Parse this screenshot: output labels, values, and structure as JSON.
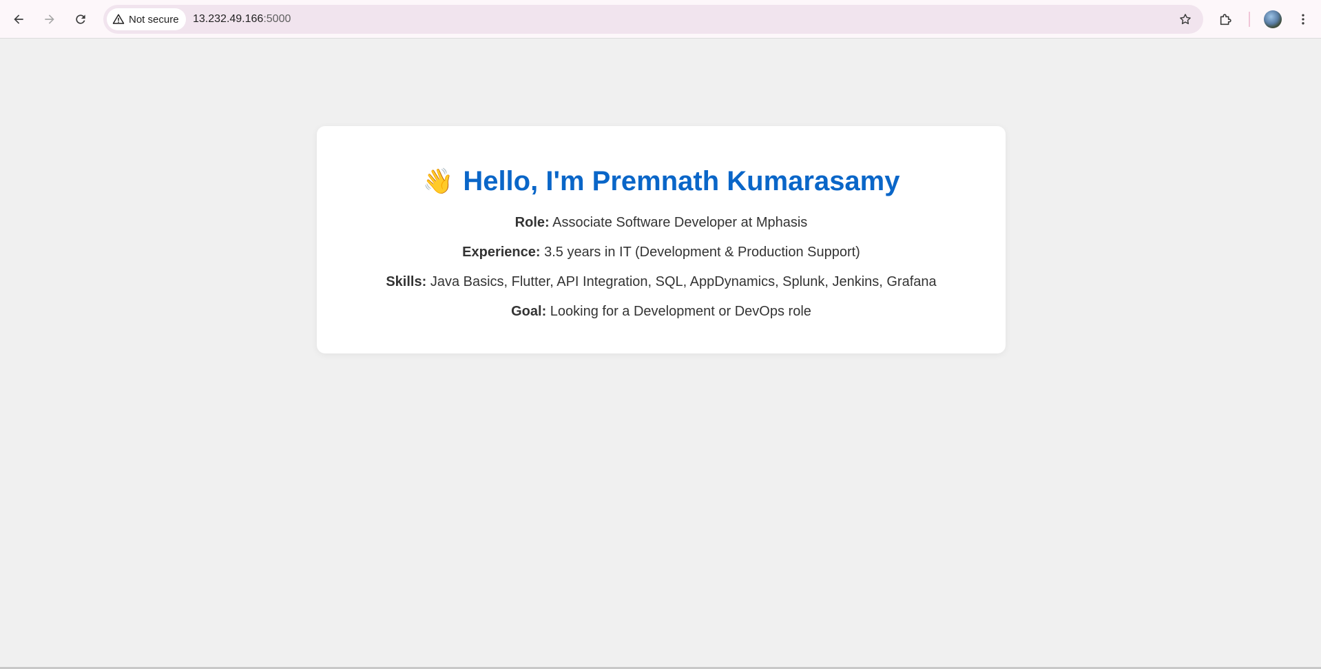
{
  "browser": {
    "security_label": "Not secure",
    "url_host": "13.232.49.166",
    "url_port": ":5000"
  },
  "icons": {
    "back": "arrow-left-icon",
    "forward": "arrow-right-icon",
    "reload": "reload-icon",
    "warning": "warning-triangle-icon",
    "bookmark": "star-icon",
    "extensions": "puzzle-icon",
    "profile": "avatar",
    "menu": "three-dots-icon",
    "wave": "waving-hand-icon"
  },
  "colors": {
    "heading": "#0a66c8",
    "text": "#333333",
    "page_background": "#f0f0f0",
    "card_background": "#ffffff",
    "omnibox": "#f1e4ee"
  },
  "profile": {
    "emoji": "👋",
    "heading": "Hello, I'm Premnath Kumarasamy",
    "role": {
      "label": "Role:",
      "value": "Associate Software Developer at Mphasis"
    },
    "experience": {
      "label": "Experience:",
      "value": "3.5 years in IT (Development & Production Support)"
    },
    "skills": {
      "label": "Skills:",
      "value": "Java Basics, Flutter, API Integration, SQL, AppDynamics, Splunk, Jenkins, Grafana"
    },
    "goal": {
      "label": "Goal:",
      "value": "Looking for a Development or DevOps role"
    }
  }
}
